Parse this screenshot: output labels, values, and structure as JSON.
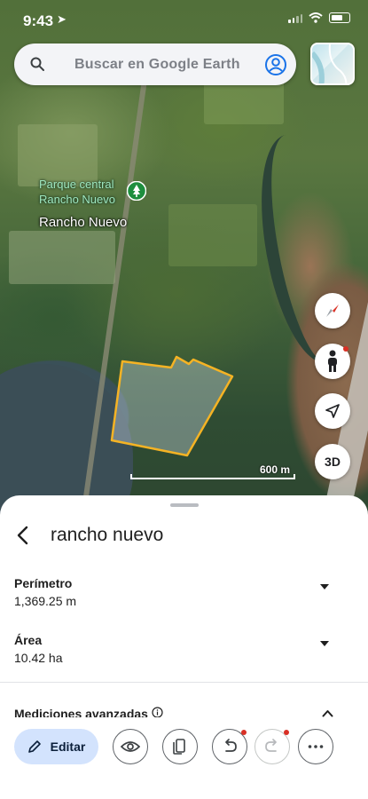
{
  "status_bar": {
    "time": "9:43",
    "location_icon": "location-arrow-icon"
  },
  "search": {
    "placeholder": "Buscar en Google Earth"
  },
  "map": {
    "poi_label": "Parque central Rancho Nuevo",
    "town_label": "Rancho Nuevo",
    "scale_label": "600 m",
    "polygon_color": "#f5b324",
    "three_d_label": "3D"
  },
  "sheet": {
    "title": "rancho nuevo",
    "measurements": [
      {
        "label": "Perímetro",
        "value": "1,369.25 m"
      },
      {
        "label": "Área",
        "value": "10.42 ha"
      }
    ],
    "advanced_label": "Mediciones avanzadas"
  },
  "toolbar": {
    "edit_label": "Editar"
  },
  "colors": {
    "accent": "#d3e3fd",
    "alert_dot": "#d93025"
  }
}
